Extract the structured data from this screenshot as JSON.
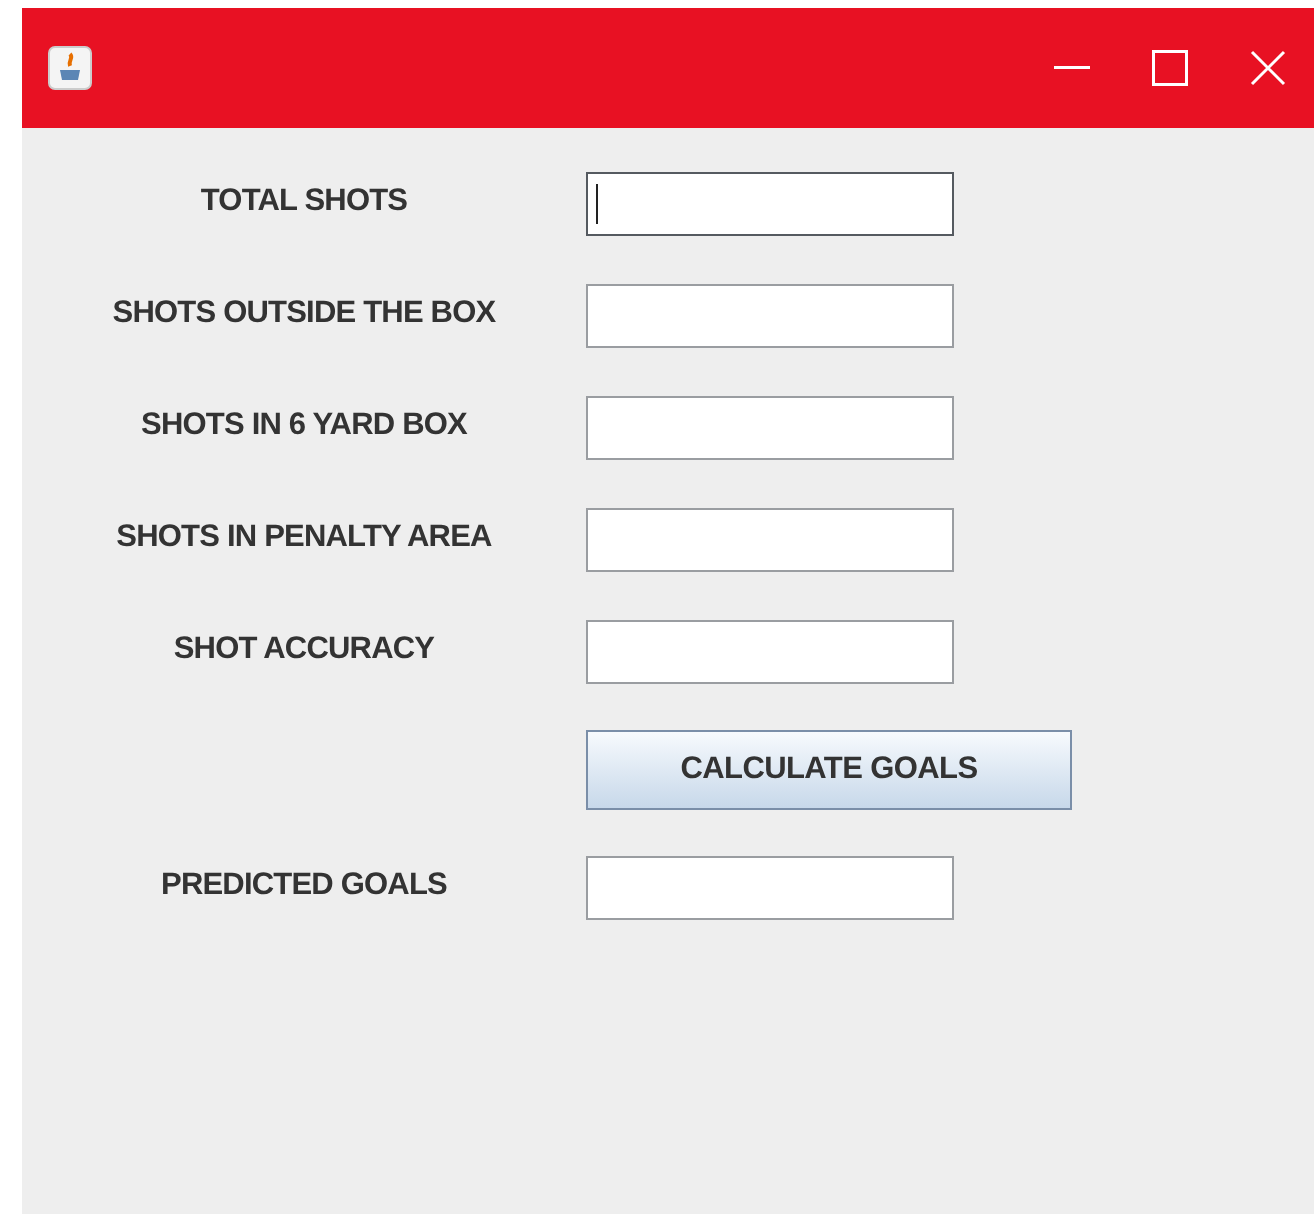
{
  "rows": [
    {
      "kind": "field",
      "label": "TOTAL SHOTS",
      "focused": true
    },
    {
      "kind": "field",
      "label": "SHOTS OUTSIDE THE BOX",
      "focused": false
    },
    {
      "kind": "field",
      "label": "SHOTS IN 6 YARD BOX",
      "focused": false
    },
    {
      "kind": "field",
      "label": "SHOTS IN PENALTY AREA",
      "focused": false
    },
    {
      "kind": "field",
      "label": "SHOT ACCURACY",
      "focused": false
    },
    {
      "kind": "button",
      "label": "CALCULATE GOALS"
    },
    {
      "kind": "field",
      "label": "PREDICTED GOALS",
      "focused": false
    }
  ]
}
